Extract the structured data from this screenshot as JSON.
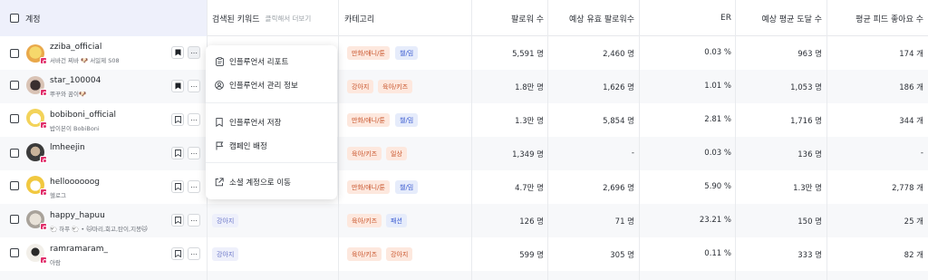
{
  "header": {
    "account": "계정",
    "keyword": "검색된 키워드",
    "keyword_hint": "클릭해서 더보기",
    "category": "카테고리",
    "followers": "팔로워 수",
    "effective_followers": "예상 유효 팔로워수",
    "er": "ER",
    "avg_reach": "예상 평균 도달 수",
    "avg_likes": "평균 피드 좋아요 수"
  },
  "menu": {
    "report": "인플루언서 리포트",
    "manage": "인플루언서 관리 정보",
    "save": "인플루언서 저장",
    "campaign": "캠페인 배정",
    "social": "소셜 계정으로 이동"
  },
  "icons": {
    "bookmark_filled": "bookmark-filled-icon",
    "bookmark_outline": "bookmark-outline-icon",
    "more": "more-horizontal-icon",
    "instagram": "instagram-icon"
  },
  "colors": {
    "accent": "#3b5bd1",
    "tag_orange_bg": "#fde8de",
    "tag_blue_bg": "#e6ecfb",
    "instagram": "#e1306c"
  },
  "rows": [
    {
      "handle": "zziba_official",
      "bio": "서바건 찌바 🐶 서일제 S08",
      "keywords": [],
      "categories": [
        "만화/애니/툰",
        "챌/밈"
      ],
      "followers": "5,591 명",
      "effective": "2,460 명",
      "er": "0.03 %",
      "reach": "963 명",
      "likes": "174 개"
    },
    {
      "handle": "star_100004",
      "bio": "뿌꾸와 꿈이🐶",
      "keywords": [],
      "categories": [
        "강아지",
        "육아/키즈"
      ],
      "followers": "1.8만 명",
      "effective": "1,626 명",
      "er": "1.01 %",
      "reach": "1,053 명",
      "likes": "186 개"
    },
    {
      "handle": "bobiboni_official",
      "bio": "밥이본이 BobiBoni",
      "keywords": [],
      "categories": [
        "만화/애니/툰",
        "챌/밈"
      ],
      "followers": "1.3만 명",
      "effective": "5,854 명",
      "er": "2.81 %",
      "reach": "1,716 명",
      "likes": "344 개"
    },
    {
      "handle": "lmheejin",
      "bio": "",
      "keywords": [],
      "categories": [
        "육아/키즈",
        "일상"
      ],
      "followers": "1,349 명",
      "effective": "-",
      "er": "0.03 %",
      "reach": "136 명",
      "likes": "-"
    },
    {
      "handle": "helloooooog",
      "bio": "헬로그",
      "keywords": [],
      "categories": [
        "만화/애니/툰",
        "챌/밈"
      ],
      "followers": "4.7만 명",
      "effective": "2,696 명",
      "er": "5.90 %",
      "reach": "1.3만 명",
      "likes": "2,778 개"
    },
    {
      "handle": "happy_hapuu",
      "bio": "🐑 하푸 🐑 • 🐱마리,회고,탄이,지봉🐱",
      "keywords": [
        "강아지"
      ],
      "categories": [
        "육아/키즈",
        "패션"
      ],
      "followers": "126 명",
      "effective": "71 명",
      "er": "23.21 %",
      "reach": "150 명",
      "likes": "25 개"
    },
    {
      "handle": "ramramaram_",
      "bio": "아람",
      "keywords": [
        "강아지"
      ],
      "categories": [
        "육아/키즈",
        "강아지"
      ],
      "followers": "599 명",
      "effective": "305 명",
      "er": "0.11 %",
      "reach": "333 명",
      "likes": "82 개"
    }
  ]
}
